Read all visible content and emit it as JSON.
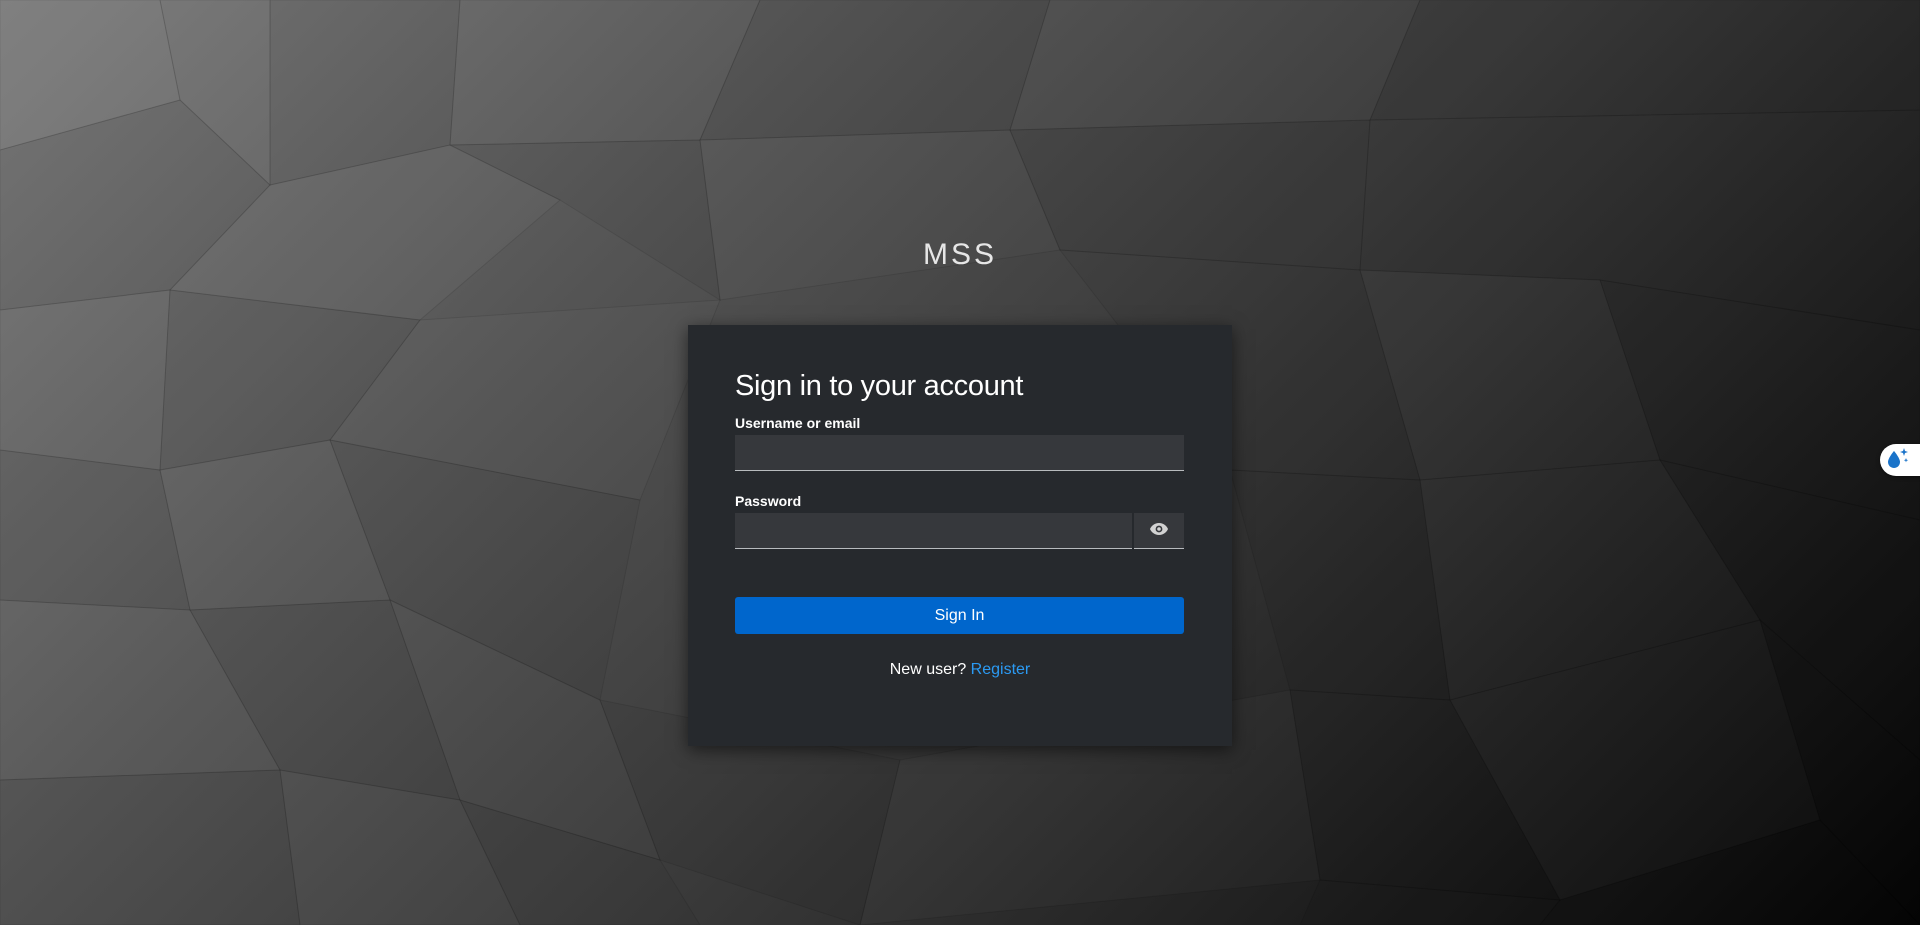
{
  "brand": {
    "title": "MSS"
  },
  "login": {
    "heading": "Sign in to your account",
    "username_label": "Username or email",
    "username_value": "",
    "password_label": "Password",
    "password_value": "",
    "sign_in_label": "Sign In",
    "new_user_text": "New user?",
    "register_label": "Register"
  },
  "icons": {
    "password_toggle": "eye-icon",
    "side_widget": "water-drop-sparkle-icon"
  },
  "colors": {
    "primary_button": "#0066cc",
    "link": "#2b9af3",
    "card_background": "#26292d",
    "input_background": "#36383c"
  }
}
